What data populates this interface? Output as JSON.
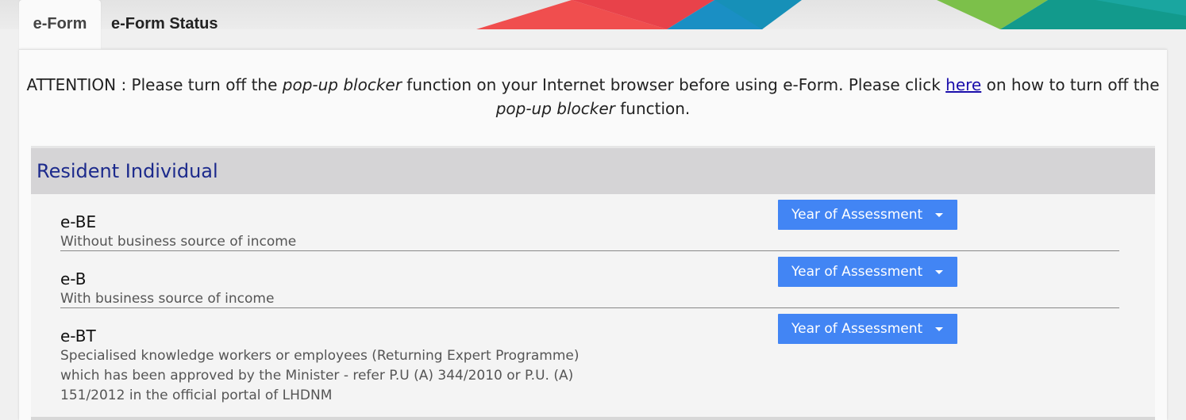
{
  "tabs": [
    {
      "label": "e-Form",
      "active": true
    },
    {
      "label": "e-Form Status",
      "active": false
    }
  ],
  "attention": {
    "prefix": "ATTENTION : Please turn off the ",
    "em1": "pop-up blocker",
    "mid": " function on your Internet browser before using e-Form. Please click ",
    "link": "here",
    "after_link": " on how to turn off the ",
    "em2": "pop-up blocker",
    "suffix": " function."
  },
  "section": {
    "title": "Resident Individual"
  },
  "forms": [
    {
      "name": "e-BE",
      "description": "Without business source of income",
      "button": "Year of Assessment"
    },
    {
      "name": "e-B",
      "description": "With business source of income",
      "button": "Year of Assessment"
    },
    {
      "name": "e-BT",
      "description": "Specialised knowledge workers or employees (Returning Expert Programme) which has been approved by the Minister - refer P.U (A) 344/2010 or P.U. (A) 151/2012 in the official portal of LHDNM",
      "button": "Year of Assessment"
    }
  ],
  "colors": {
    "button": "#4285f4",
    "section_title": "#1c2a8c",
    "link": "#1a0dab",
    "banner_red": "#f04e4e",
    "banner_blue": "#1a8fc4",
    "banner_teal": "#129a8c",
    "banner_green": "#7cc04a"
  }
}
